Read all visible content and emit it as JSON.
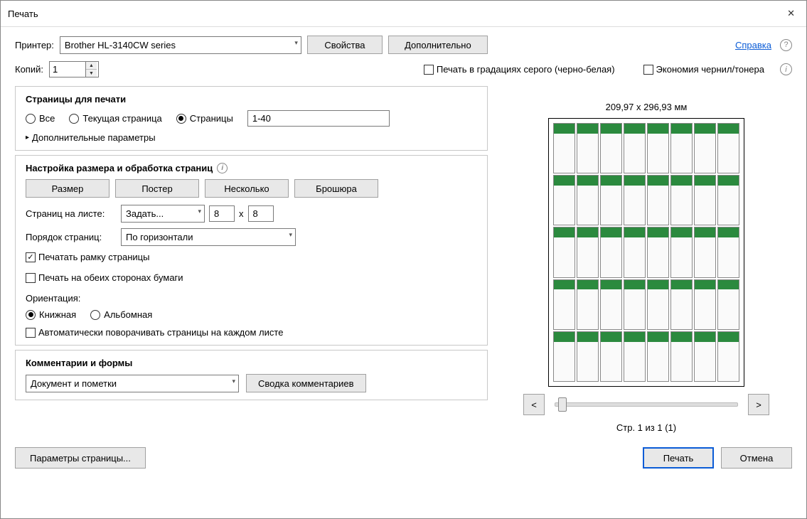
{
  "window": {
    "title": "Печать"
  },
  "printer": {
    "label": "Принтер:",
    "value": "Brother HL-3140CW series",
    "properties_btn": "Свойства",
    "advanced_btn": "Дополнительно"
  },
  "help_link": "Справка",
  "copies": {
    "label": "Копий:",
    "value": "1"
  },
  "grayscale": {
    "label": "Печать в градациях серого (черно-белая)",
    "checked": false
  },
  "ink_save": {
    "label": "Экономия чернил/тонера",
    "checked": false
  },
  "pages_section": {
    "title": "Страницы для печати",
    "all": "Все",
    "current": "Текущая страница",
    "pages": "Страницы",
    "pages_value": "1-40",
    "more": "Дополнительные параметры"
  },
  "handling": {
    "title": "Настройка размера и обработка страниц",
    "btns": {
      "size": "Размер",
      "poster": "Постер",
      "multiple": "Несколько",
      "booklet": "Брошюра"
    },
    "per_sheet_label": "Страниц на листе:",
    "per_sheet_mode": "Задать...",
    "cols": "8",
    "x": "x",
    "rows": "8",
    "order_label": "Порядок страниц:",
    "order_value": "По горизонтали",
    "print_border": "Печатать рамку страницы",
    "duplex": "Печать на обеих сторонах бумаги",
    "orientation_label": "Ориентация:",
    "portrait": "Книжная",
    "landscape": "Альбомная",
    "auto_rotate": "Автоматически поворачивать страницы на каждом листе"
  },
  "comments": {
    "title": "Комментарии и формы",
    "value": "Документ и пометки",
    "summary_btn": "Сводка комментариев"
  },
  "preview": {
    "dimensions": "209,97 x 296,93 мм",
    "prev": "<",
    "next": ">",
    "counter": "Стр. 1 из 1 (1)"
  },
  "footer": {
    "page_setup": "Параметры страницы...",
    "print": "Печать",
    "cancel": "Отмена"
  }
}
